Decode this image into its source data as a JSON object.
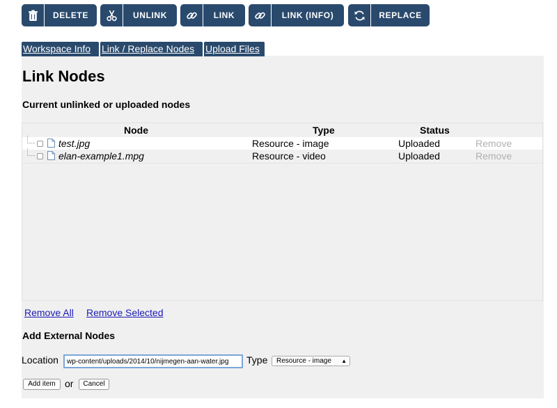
{
  "toolbar": {
    "buttons": [
      {
        "label": "DELETE",
        "icon": "trash-icon"
      },
      {
        "label": "UNLINK",
        "icon": "scissors-icon"
      },
      {
        "label": "LINK",
        "icon": "link-icon"
      },
      {
        "label": "LINK (INFO)",
        "icon": "link-icon"
      },
      {
        "label": "REPLACE",
        "icon": "refresh-icon"
      }
    ]
  },
  "tabs": [
    "Workspace Info",
    "Link / Replace Nodes",
    "Upload Files"
  ],
  "page": {
    "title": "Link Nodes",
    "subtitle": "Current unlinked or uploaded nodes"
  },
  "table": {
    "columns": [
      "Node",
      "Type",
      "Status"
    ],
    "rows": [
      {
        "name": "test.jpg",
        "type": "Resource - image",
        "status": "Uploaded",
        "action": "Remove"
      },
      {
        "name": "elan-example1.mpg",
        "type": "Resource - video",
        "status": "Uploaded",
        "action": "Remove"
      }
    ]
  },
  "actions": {
    "remove_all": "Remove All",
    "remove_selected": "Remove Selected"
  },
  "external": {
    "title": "Add External Nodes",
    "location_label": "Location",
    "location_value": "wp-content/uploads/2014/10/nijmegen-aan-water.jpg",
    "type_label": "Type",
    "type_selected": "Resource - image",
    "add_button": "Add item",
    "or_text": "or",
    "cancel_button": "Cancel"
  },
  "colors": {
    "toolbar_bg": "#2a4a6d",
    "link": "#1a1ab5"
  }
}
